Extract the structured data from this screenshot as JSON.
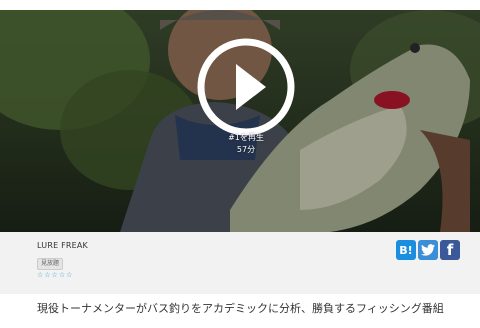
{
  "video": {
    "play_count": "#1を再生",
    "duration": "57分"
  },
  "program": {
    "title": "LURE FREAK",
    "badge": "見放題",
    "rating_stars": "☆☆☆☆☆",
    "description": "現役トーナメンターがバス釣りをアカデミックに分析、勝負するフィッシング番組"
  },
  "share": {
    "hatena_label": "B!",
    "facebook_label": "f"
  },
  "icons": {
    "play": "play-icon",
    "hatena": "hatena-bookmark-icon",
    "twitter": "twitter-bird-icon",
    "facebook": "facebook-icon"
  },
  "colors": {
    "star_accent": "#2aa0c6",
    "hatena_blue": "#1b8ee0",
    "twitter_blue": "#3b8fd8",
    "facebook_blue": "#3b5998",
    "info_bg": "#f2f2f2"
  }
}
